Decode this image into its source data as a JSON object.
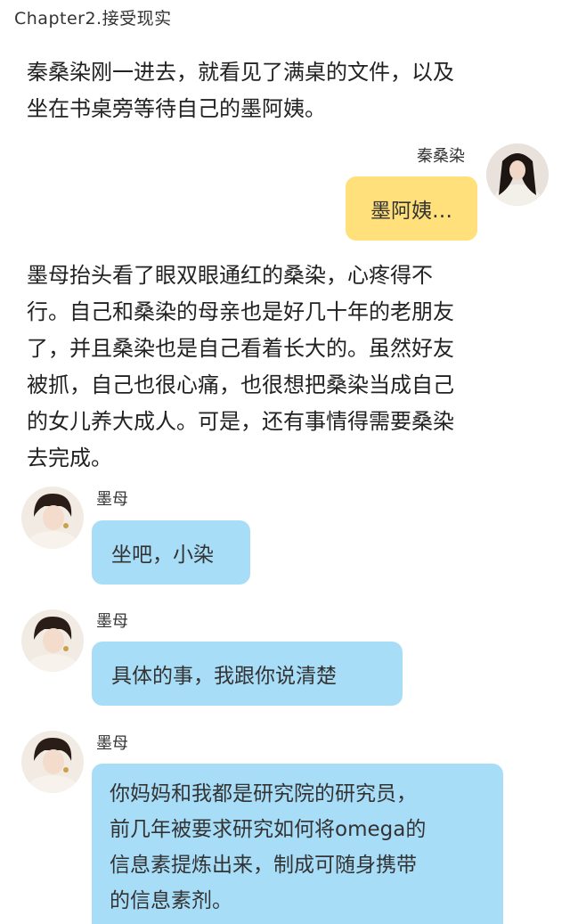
{
  "chapter": {
    "title": "Chapter2.接受现实"
  },
  "narration": {
    "p1": [
      "秦桑染刚一进去，就看见了满桌的文件，以及",
      "坐在书桌旁等待自己的墨阿姨。"
    ],
    "p2": [
      "墨母抬头看了眼双眼通红的桑染，心疼得不",
      "行。自己和桑染的母亲也是好几十年的老朋友",
      "了，并且桑染也是自己看着长大的。虽然好友",
      "被抓，自己也很心痛，也很想把桑染当成自己",
      "的女儿养大成人。可是，还有事情得需要桑染",
      "去完成。"
    ]
  },
  "chat": {
    "right": {
      "speaker": "秦桑染",
      "message": "墨阿姨…"
    },
    "left1": {
      "speaker": "墨母",
      "message": "坐吧，小染"
    },
    "left2": {
      "speaker": "墨母",
      "message": "具体的事，我跟你说清楚"
    },
    "left3": {
      "speaker": "墨母",
      "lines": [
        "你妈妈和我都是研究院的研究员，",
        "前几年被要求研究如何将omega的",
        "信息素提炼出来，制成可随身携带",
        "的信息素剂。"
      ]
    }
  },
  "colors": {
    "right_bubble": "#ffe07a",
    "left_bubble": "#a8ddf8"
  }
}
